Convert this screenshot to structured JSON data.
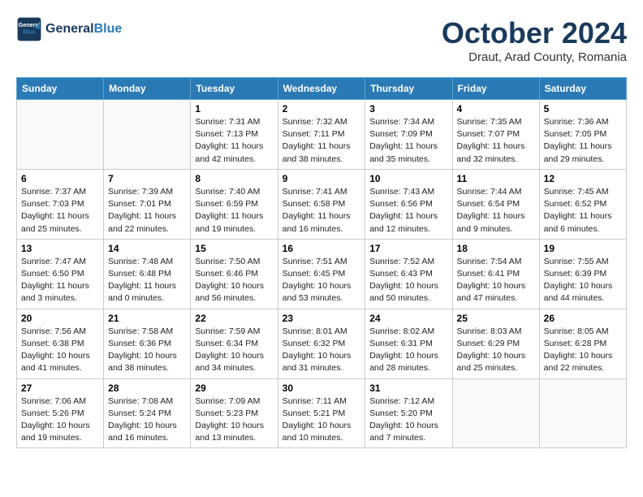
{
  "header": {
    "logo_line1": "General",
    "logo_line2": "Blue",
    "month_title": "October 2024",
    "location": "Draut, Arad County, Romania"
  },
  "weekdays": [
    "Sunday",
    "Monday",
    "Tuesday",
    "Wednesday",
    "Thursday",
    "Friday",
    "Saturday"
  ],
  "weeks": [
    [
      {
        "day": "",
        "info": ""
      },
      {
        "day": "",
        "info": ""
      },
      {
        "day": "1",
        "info": "Sunrise: 7:31 AM\nSunset: 7:13 PM\nDaylight: 11 hours and 42 minutes."
      },
      {
        "day": "2",
        "info": "Sunrise: 7:32 AM\nSunset: 7:11 PM\nDaylight: 11 hours and 38 minutes."
      },
      {
        "day": "3",
        "info": "Sunrise: 7:34 AM\nSunset: 7:09 PM\nDaylight: 11 hours and 35 minutes."
      },
      {
        "day": "4",
        "info": "Sunrise: 7:35 AM\nSunset: 7:07 PM\nDaylight: 11 hours and 32 minutes."
      },
      {
        "day": "5",
        "info": "Sunrise: 7:36 AM\nSunset: 7:05 PM\nDaylight: 11 hours and 29 minutes."
      }
    ],
    [
      {
        "day": "6",
        "info": "Sunrise: 7:37 AM\nSunset: 7:03 PM\nDaylight: 11 hours and 25 minutes."
      },
      {
        "day": "7",
        "info": "Sunrise: 7:39 AM\nSunset: 7:01 PM\nDaylight: 11 hours and 22 minutes."
      },
      {
        "day": "8",
        "info": "Sunrise: 7:40 AM\nSunset: 6:59 PM\nDaylight: 11 hours and 19 minutes."
      },
      {
        "day": "9",
        "info": "Sunrise: 7:41 AM\nSunset: 6:58 PM\nDaylight: 11 hours and 16 minutes."
      },
      {
        "day": "10",
        "info": "Sunrise: 7:43 AM\nSunset: 6:56 PM\nDaylight: 11 hours and 12 minutes."
      },
      {
        "day": "11",
        "info": "Sunrise: 7:44 AM\nSunset: 6:54 PM\nDaylight: 11 hours and 9 minutes."
      },
      {
        "day": "12",
        "info": "Sunrise: 7:45 AM\nSunset: 6:52 PM\nDaylight: 11 hours and 6 minutes."
      }
    ],
    [
      {
        "day": "13",
        "info": "Sunrise: 7:47 AM\nSunset: 6:50 PM\nDaylight: 11 hours and 3 minutes."
      },
      {
        "day": "14",
        "info": "Sunrise: 7:48 AM\nSunset: 6:48 PM\nDaylight: 11 hours and 0 minutes."
      },
      {
        "day": "15",
        "info": "Sunrise: 7:50 AM\nSunset: 6:46 PM\nDaylight: 10 hours and 56 minutes."
      },
      {
        "day": "16",
        "info": "Sunrise: 7:51 AM\nSunset: 6:45 PM\nDaylight: 10 hours and 53 minutes."
      },
      {
        "day": "17",
        "info": "Sunrise: 7:52 AM\nSunset: 6:43 PM\nDaylight: 10 hours and 50 minutes."
      },
      {
        "day": "18",
        "info": "Sunrise: 7:54 AM\nSunset: 6:41 PM\nDaylight: 10 hours and 47 minutes."
      },
      {
        "day": "19",
        "info": "Sunrise: 7:55 AM\nSunset: 6:39 PM\nDaylight: 10 hours and 44 minutes."
      }
    ],
    [
      {
        "day": "20",
        "info": "Sunrise: 7:56 AM\nSunset: 6:38 PM\nDaylight: 10 hours and 41 minutes."
      },
      {
        "day": "21",
        "info": "Sunrise: 7:58 AM\nSunset: 6:36 PM\nDaylight: 10 hours and 38 minutes."
      },
      {
        "day": "22",
        "info": "Sunrise: 7:59 AM\nSunset: 6:34 PM\nDaylight: 10 hours and 34 minutes."
      },
      {
        "day": "23",
        "info": "Sunrise: 8:01 AM\nSunset: 6:32 PM\nDaylight: 10 hours and 31 minutes."
      },
      {
        "day": "24",
        "info": "Sunrise: 8:02 AM\nSunset: 6:31 PM\nDaylight: 10 hours and 28 minutes."
      },
      {
        "day": "25",
        "info": "Sunrise: 8:03 AM\nSunset: 6:29 PM\nDaylight: 10 hours and 25 minutes."
      },
      {
        "day": "26",
        "info": "Sunrise: 8:05 AM\nSunset: 6:28 PM\nDaylight: 10 hours and 22 minutes."
      }
    ],
    [
      {
        "day": "27",
        "info": "Sunrise: 7:06 AM\nSunset: 5:26 PM\nDaylight: 10 hours and 19 minutes."
      },
      {
        "day": "28",
        "info": "Sunrise: 7:08 AM\nSunset: 5:24 PM\nDaylight: 10 hours and 16 minutes."
      },
      {
        "day": "29",
        "info": "Sunrise: 7:09 AM\nSunset: 5:23 PM\nDaylight: 10 hours and 13 minutes."
      },
      {
        "day": "30",
        "info": "Sunrise: 7:11 AM\nSunset: 5:21 PM\nDaylight: 10 hours and 10 minutes."
      },
      {
        "day": "31",
        "info": "Sunrise: 7:12 AM\nSunset: 5:20 PM\nDaylight: 10 hours and 7 minutes."
      },
      {
        "day": "",
        "info": ""
      },
      {
        "day": "",
        "info": ""
      }
    ]
  ]
}
